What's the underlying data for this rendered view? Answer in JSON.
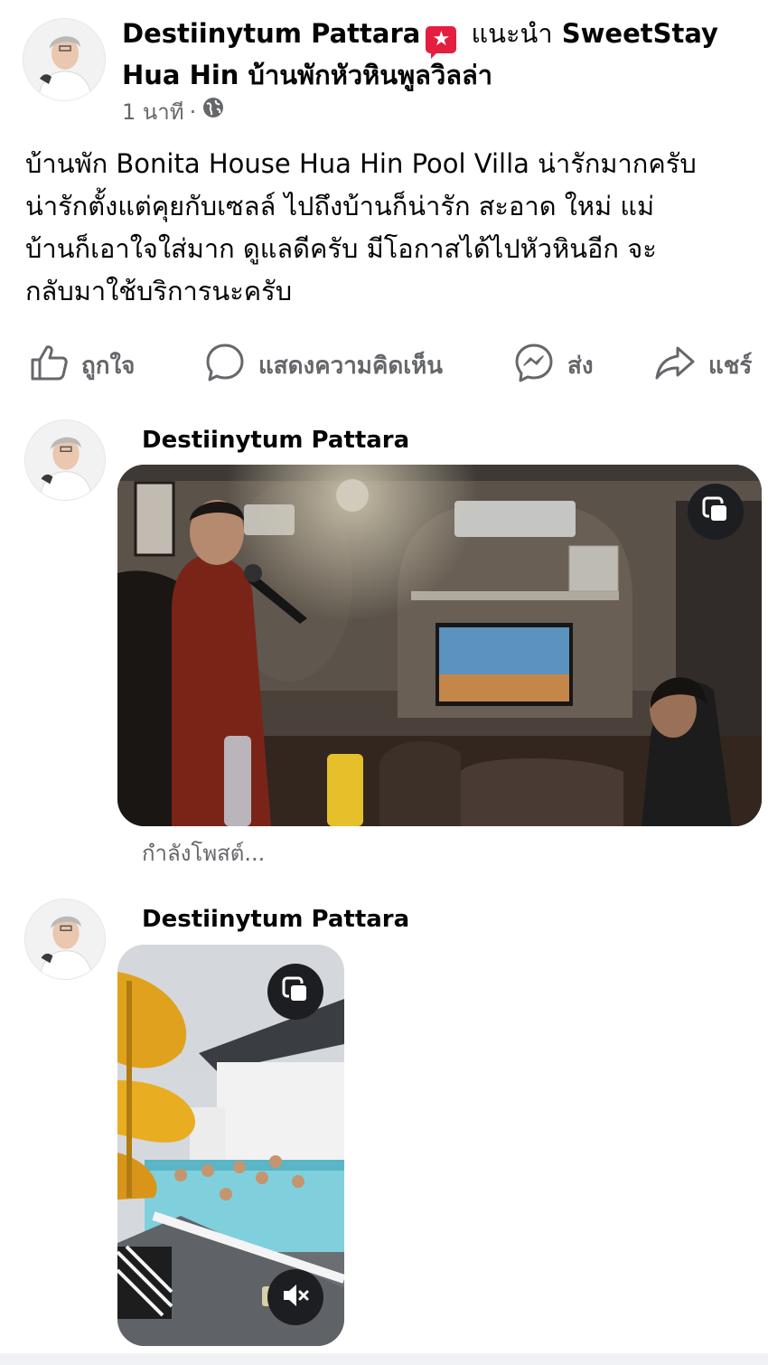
{
  "post": {
    "author": "Destiinytum Pattara",
    "recommends_label": "แนะนำ",
    "page_name": "SweetStay Hua Hin บ้านพักหัวหินพูลวิลล่า",
    "time": "1 นาที",
    "separator": "·",
    "privacy_icon": "globe-icon",
    "recommend_badge_icon": "star-badge-icon",
    "text": "บ้านพัก Bonita House Hua Hin Pool Villa น่ารักมากครับ\nน่ารักตั้งแต่คุยกับเซลล์ ไปถึงบ้านก็น่ารัก สะอาด ใหม่  แม่\nบ้านก็เอาใจใส่มาก ดูแลดีครับ มีโอกาสได้ไปหัวหินอีก จะ\nกลับมาใช้บริการนะครับ"
  },
  "actions": {
    "like": "ถูกใจ",
    "comment": "แสดงความคิดเห็น",
    "send": "ส่ง",
    "share": "แชร์"
  },
  "comments": [
    {
      "author": "Destiinytum Pattara",
      "media_type": "photo",
      "status": "กำลังโพสต์..."
    },
    {
      "author": "Destiinytum Pattara",
      "media_type": "video",
      "mute_icon": "muted-speaker-icon"
    }
  ],
  "colors": {
    "text_primary": "#050505",
    "text_secondary": "#65676b",
    "badge_red": "#e41e3f",
    "media_button_bg": "#1c1e21"
  }
}
